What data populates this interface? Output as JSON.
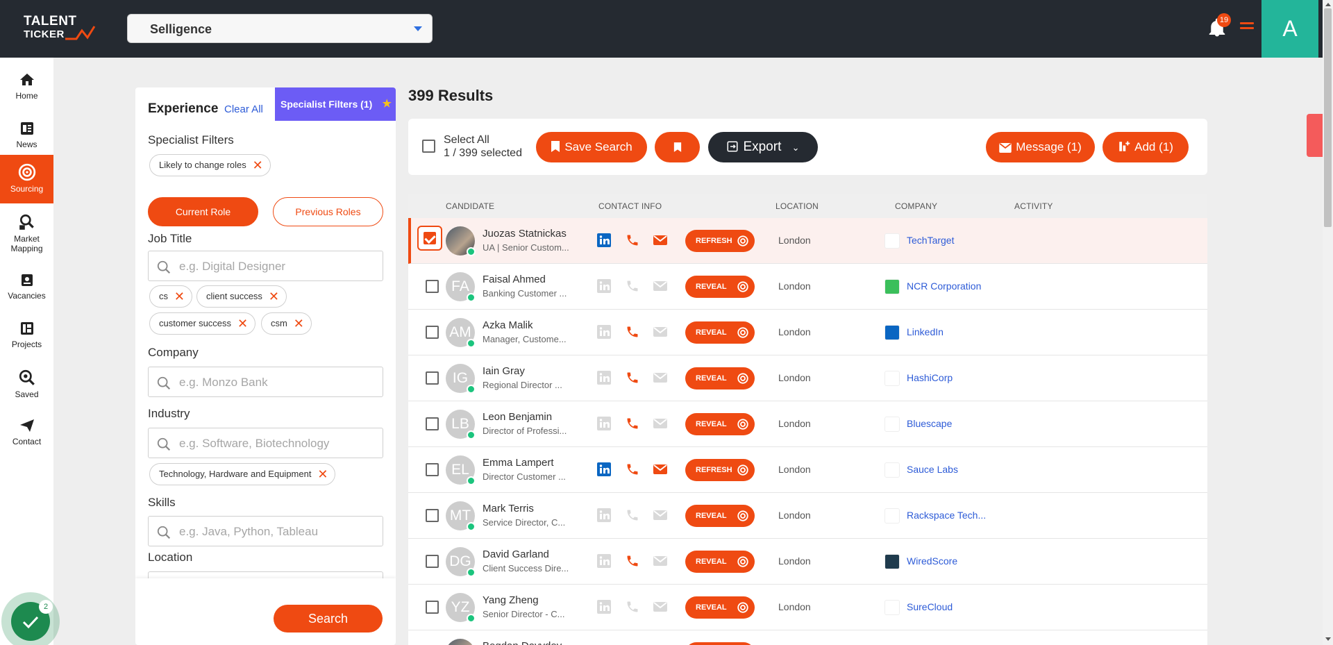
{
  "app": {
    "logo_line1": "TALENT",
    "logo_line2": "TICKER",
    "org_selected": "Selligence",
    "notifications_count": "19",
    "user_initial": "A",
    "accent": "#ef4a12",
    "task_count": "2"
  },
  "nav": [
    {
      "label": "Home",
      "icon": "home-icon"
    },
    {
      "label": "News",
      "icon": "news-icon"
    },
    {
      "label": "Sourcing",
      "icon": "target-icon",
      "active": true
    },
    {
      "label": "Market Mapping",
      "icon": "market-mapping-icon"
    },
    {
      "label": "Vacancies",
      "icon": "vacancies-icon"
    },
    {
      "label": "Projects",
      "icon": "projects-icon"
    },
    {
      "label": "Saved",
      "icon": "saved-icon"
    },
    {
      "label": "Contact",
      "icon": "send-icon"
    }
  ],
  "filters": {
    "title": "Experience",
    "clear_all": "Clear All",
    "specialist_tab": "Specialist Filters (1)",
    "specialist_label": "Specialist Filters",
    "specialist_chips": [
      "Likely to change roles"
    ],
    "current_role": "Current Role",
    "previous_roles": "Previous Roles",
    "job_title_label": "Job Title",
    "job_title_placeholder": "e.g. Digital Designer",
    "job_title_chips": [
      "cs",
      "client success",
      "customer success",
      "csm"
    ],
    "company_label": "Company",
    "company_placeholder": "e.g. Monzo Bank",
    "industry_label": "Industry",
    "industry_placeholder": "e.g. Software, Biotechnology",
    "industry_chips": [
      "Technology, Hardware and Equipment"
    ],
    "skills_label": "Skills",
    "skills_placeholder": "e.g. Java, Python, Tableau",
    "location_label": "Location",
    "search_button": "Search"
  },
  "results": {
    "title": "399 Results",
    "select_all": "Select All",
    "selected_count": "1 / 399 selected",
    "save_search": "Save Search",
    "export": "Export",
    "message": "Message (1)",
    "add": "Add (1)",
    "columns": [
      "CANDIDATE",
      "CONTACT INFO",
      "LOCATION",
      "COMPANY",
      "ACTIVITY"
    ],
    "rows": [
      {
        "initials": "",
        "name": "Juozas Statnickas",
        "title": "UA | Senior Custom...",
        "action": "REFRESH",
        "location": "London",
        "company": "TechTarget",
        "selected": true,
        "li": true,
        "ph": true,
        "em": true
      },
      {
        "initials": "FA",
        "name": "Faisal Ahmed",
        "title": "Banking Customer ...",
        "action": "REVEAL",
        "location": "London",
        "company": "NCR Corporation",
        "li": false,
        "ph": false,
        "em": false
      },
      {
        "initials": "AM",
        "name": "Azka Malik",
        "title": "Manager, Custome...",
        "action": "REVEAL",
        "location": "London",
        "company": "LinkedIn",
        "li": false,
        "ph": true,
        "em": false
      },
      {
        "initials": "IG",
        "name": "Iain Gray",
        "title": "Regional Director ...",
        "action": "REVEAL",
        "location": "London",
        "company": "HashiCorp",
        "li": false,
        "ph": true,
        "em": false
      },
      {
        "initials": "LB",
        "name": "Leon Benjamin",
        "title": "Director of Professi...",
        "action": "REVEAL",
        "location": "London",
        "company": "Bluescape",
        "li": false,
        "ph": true,
        "em": false
      },
      {
        "initials": "EL",
        "name": "Emma Lampert",
        "title": "Director Customer ...",
        "action": "REFRESH",
        "location": "London",
        "company": "Sauce Labs",
        "li": true,
        "ph": true,
        "em": true
      },
      {
        "initials": "MT",
        "name": "Mark Terris",
        "title": "Service Director, C...",
        "action": "REVEAL",
        "location": "London",
        "company": "Rackspace Tech...",
        "li": false,
        "ph": false,
        "em": false
      },
      {
        "initials": "DG",
        "name": "David Garland",
        "title": "Client Success Dire...",
        "action": "REVEAL",
        "location": "London",
        "company": "WiredScore",
        "li": false,
        "ph": true,
        "em": false
      },
      {
        "initials": "YZ",
        "name": "Yang Zheng",
        "title": "Senior Director - C...",
        "action": "REVEAL",
        "location": "London",
        "company": "SureCloud",
        "li": false,
        "ph": false,
        "em": false
      },
      {
        "initials": "",
        "name": "Bogdan Davydov",
        "title": "",
        "action": "REVEAL",
        "location": "",
        "company": "",
        "li": false,
        "ph": false,
        "em": false
      }
    ]
  }
}
